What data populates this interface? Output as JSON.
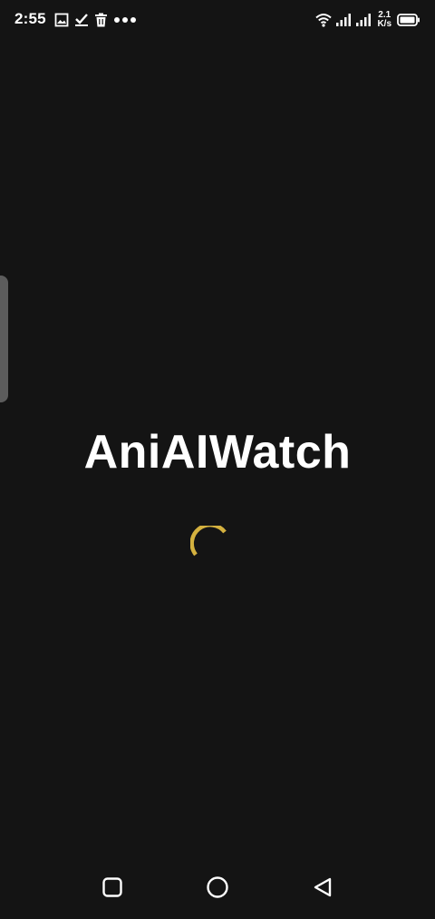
{
  "status_bar": {
    "time": "2:55",
    "notification_icons": [
      "image-icon",
      "check-icon",
      "trash-icon",
      "more-dots-icon"
    ],
    "network_speed_value": "2.1",
    "network_speed_unit": "K/s",
    "icons": [
      "wifi-icon",
      "signal-icon",
      "signal-icon",
      "battery-icon"
    ]
  },
  "splash": {
    "title": "AniAIWatch",
    "spinner_color": "#d4b13f"
  },
  "nav_bar": {
    "buttons": [
      "recent-apps",
      "home",
      "back"
    ]
  },
  "colors": {
    "background": "#141414",
    "text": "#ffffff",
    "accent": "#d4b13f",
    "edge_handle": "#5c5c5c"
  }
}
